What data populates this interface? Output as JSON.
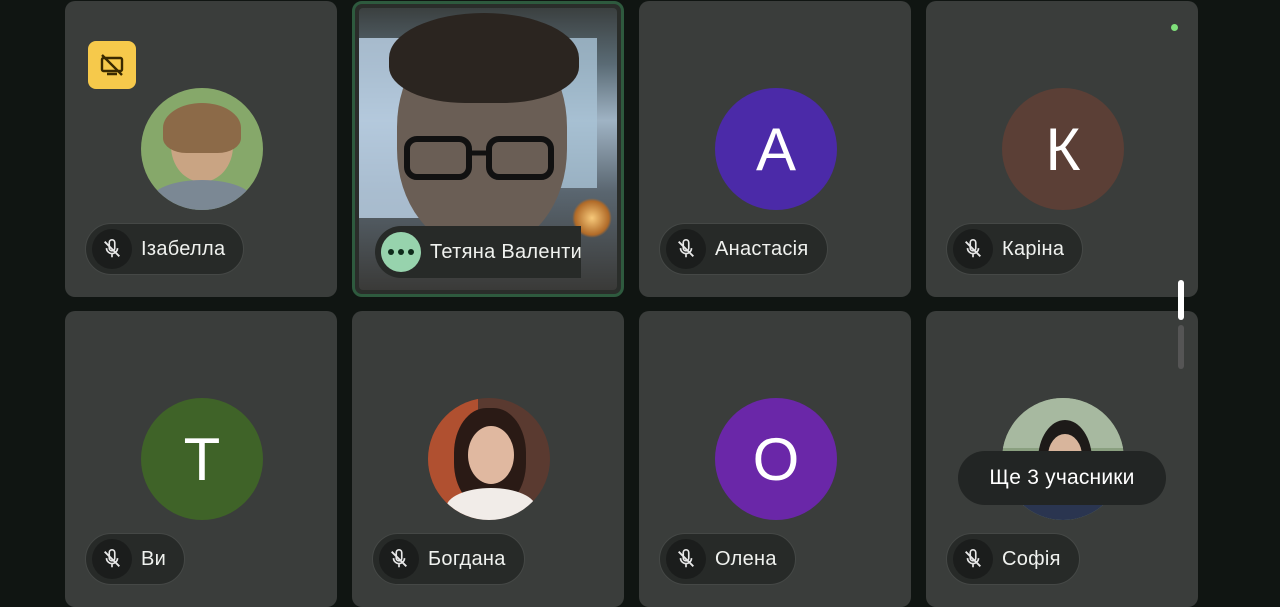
{
  "participants": [
    {
      "name": "Ізабелла",
      "muted": true,
      "avatar_type": "photo"
    },
    {
      "name": "Тетяна Валенти",
      "speaking": true,
      "avatar_type": "video"
    },
    {
      "name": "Анастасія",
      "muted": true,
      "avatar_type": "initial",
      "initial": "А",
      "color": "#4b2aa8"
    },
    {
      "name": "Каріна",
      "muted": true,
      "avatar_type": "initial",
      "initial": "К",
      "color": "#5b3f36"
    },
    {
      "name": "Ви",
      "muted": true,
      "avatar_type": "initial",
      "initial": "Т",
      "color": "#3f6328"
    },
    {
      "name": "Богдана",
      "muted": true,
      "avatar_type": "photo"
    },
    {
      "name": "Олена",
      "muted": true,
      "avatar_type": "initial",
      "initial": "О",
      "color": "#6a27a8"
    },
    {
      "name": "Софія",
      "muted": true,
      "avatar_type": "photo"
    }
  ],
  "more_participants_label": "Ще 3 учасники",
  "icons": {
    "muted_mic": "mic-off-icon",
    "screen_share_off": "screen-share-off-icon",
    "speaking": "speaking-dots-icon"
  },
  "colors": {
    "tile_bg": "#3a3d3b",
    "page_bg": "#101512",
    "active_border": "#2e5a3e",
    "badge_yellow": "#f6c94b",
    "speaking_green": "#97d3ad"
  }
}
